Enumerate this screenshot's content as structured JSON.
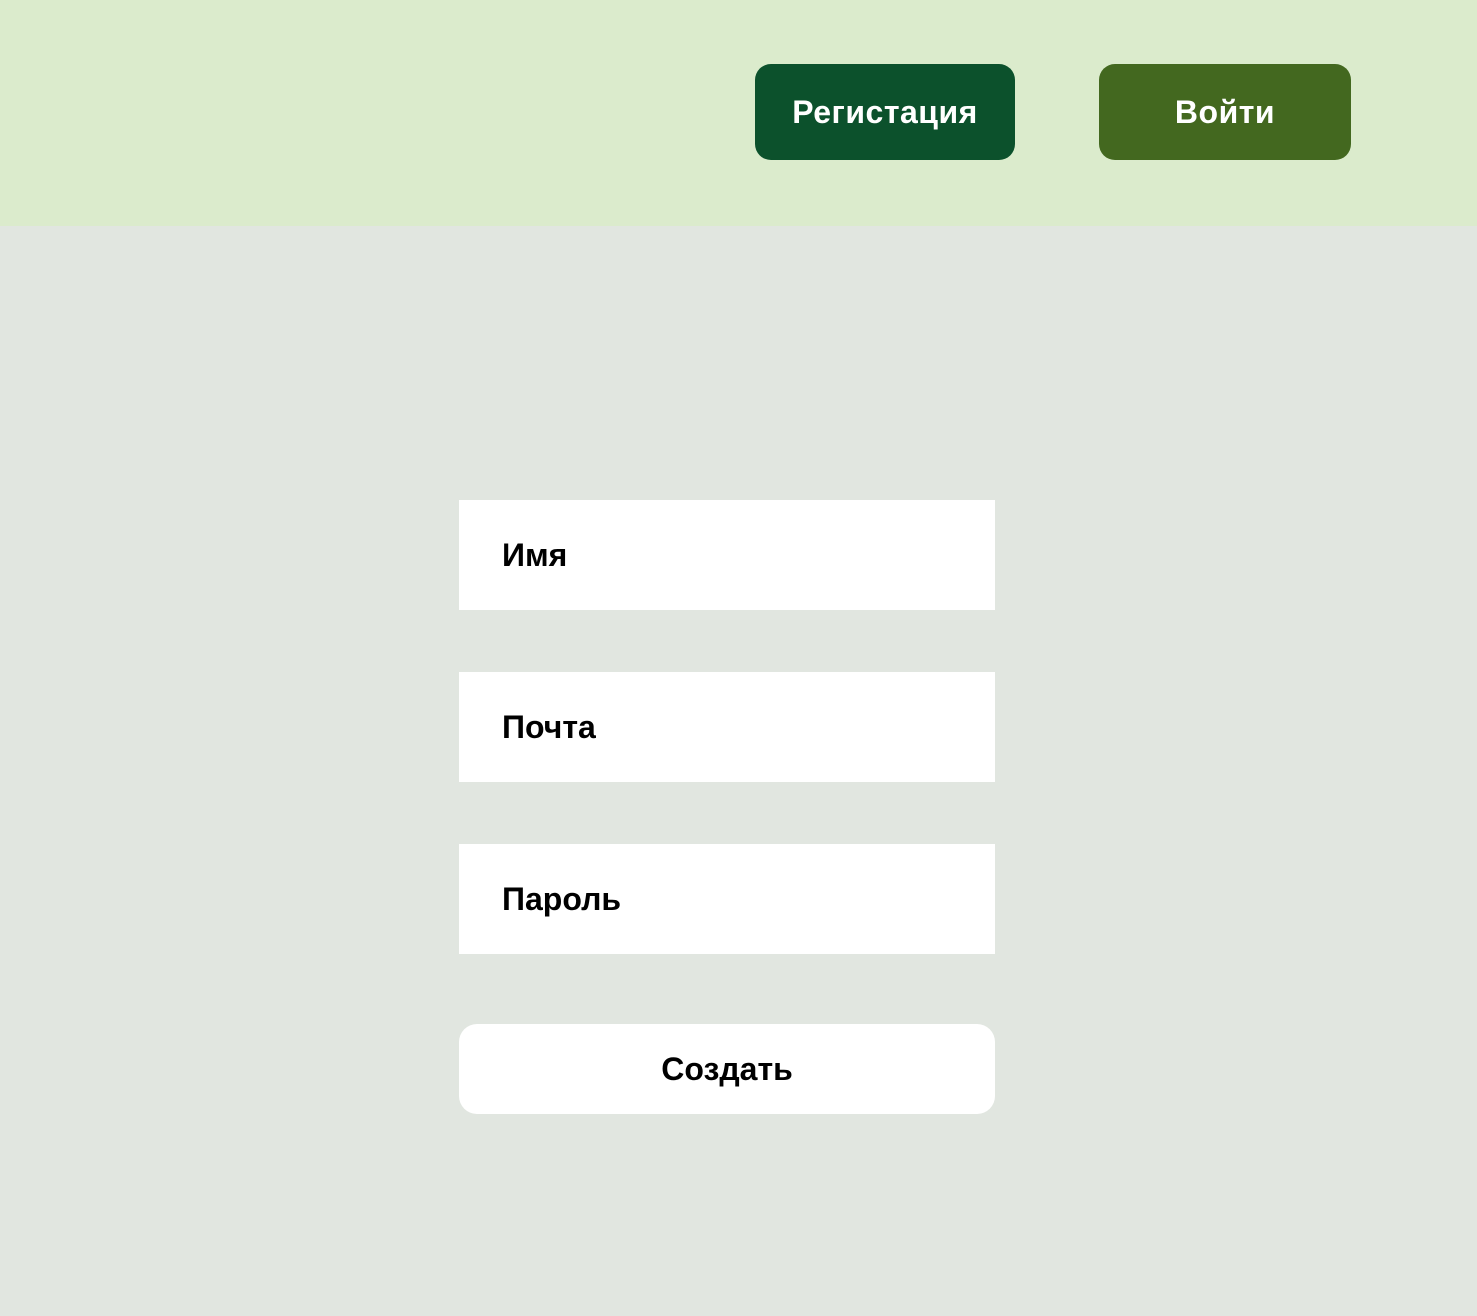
{
  "header": {
    "register_label": "Регистация",
    "login_label": "Войти"
  },
  "form": {
    "name_placeholder": "Имя",
    "email_placeholder": "Почта",
    "password_placeholder": "Пароль",
    "submit_label": "Создать"
  },
  "colors": {
    "page_background": "#e1e6e0",
    "header_background": "#dbebcc",
    "register_button": "#0c512c",
    "login_button": "#43681f",
    "field_background": "#ffffff"
  }
}
